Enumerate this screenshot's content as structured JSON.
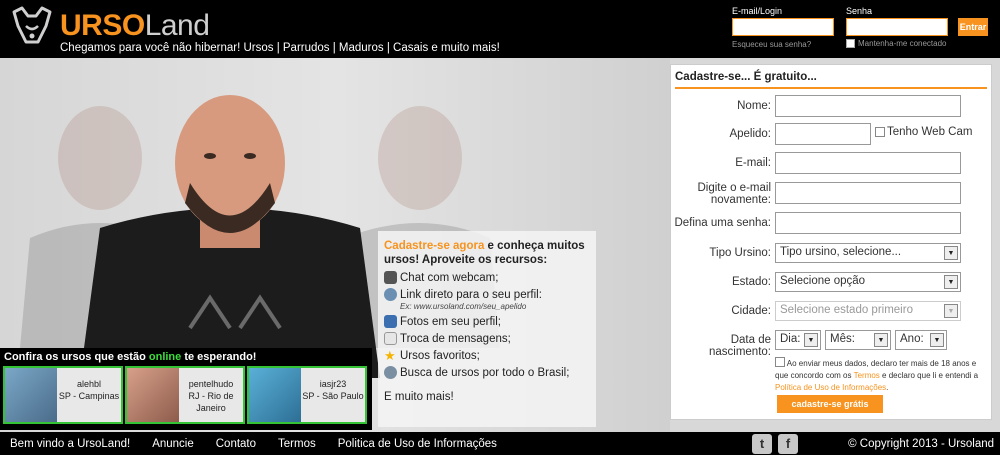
{
  "header": {
    "logo_urso": "URSO",
    "logo_land": "Land",
    "tagline": "Chegamos para você não hibernar! Ursos | Parrudos | Maduros | Casais e muito mais!"
  },
  "login": {
    "email_label": "E-mail/Login",
    "password_label": "Senha",
    "forgot": "Esqueceu sua senha?",
    "keep": "Mantenha-me conectado",
    "enter": "Entrar"
  },
  "features": {
    "cta": "Cadastre-se agora",
    "intro_rest": " e conheça muitos ursos! Aproveite os recursos:",
    "items": [
      {
        "label": "Chat com webcam;",
        "icon": "webcam-icon"
      },
      {
        "label": "Link direto para o seu perfil:",
        "icon": "globe-icon"
      },
      {
        "label": "Fotos em seu perfil;",
        "icon": "photo-icon"
      },
      {
        "label": "Troca de mensagens;",
        "icon": "envelope-icon"
      },
      {
        "label": "Ursos favoritos;",
        "icon": "star-icon"
      },
      {
        "label": "Busca de ursos por todo o Brasil;",
        "icon": "search-icon"
      }
    ],
    "link_example": "Ex: www.ursoland.com/seu_apelido",
    "more": "E muito mais!"
  },
  "online": {
    "title_a": "Confira os ursos que estão ",
    "title_online": "online",
    "title_b": " te esperando!",
    "users": [
      {
        "name": "alehbl",
        "location": "SP - Campinas"
      },
      {
        "name": "pentelhudo",
        "location": "RJ - Rio de Janeiro"
      },
      {
        "name": "iasjr23",
        "location": "SP - São Paulo"
      }
    ]
  },
  "signup": {
    "title": "Cadastre-se... É gratuito...",
    "nome": "Nome:",
    "apelido": "Apelido:",
    "webcam": "Tenho Web Cam",
    "email": "E-mail:",
    "email2": "Digite o e-mail novamente:",
    "senha": "Defina uma senha:",
    "tipo": "Tipo Ursino:",
    "tipo_value": "Tipo ursino, selecione...",
    "estado": "Estado:",
    "estado_value": "Selecione opção",
    "cidade": "Cidade:",
    "cidade_value": "Selecione estado primeiro",
    "nascimento": "Data de nascimento:",
    "dia": "Dia:",
    "mes": "Mês:",
    "ano": "Ano:",
    "terms_a": "Ao enviar meus dados, declaro ter mais de 18 anos e que concordo com os ",
    "terms_termos": "Termos",
    "terms_b": " e declaro que li e entendi a ",
    "terms_politica": "Política de Uso de Informações",
    "terms_end": ".",
    "submit": "cadastre-se grátis"
  },
  "footer": {
    "links": [
      "Bem vindo a UrsoLand!",
      "Anuncie",
      "Contato",
      "Termos",
      "Politica de Uso de Informações"
    ],
    "copyright": "© Copyright 2013 - Ursoland"
  },
  "colors": {
    "accent": "#f7931e",
    "online_green": "#35c435",
    "header_bg": "#000000"
  }
}
